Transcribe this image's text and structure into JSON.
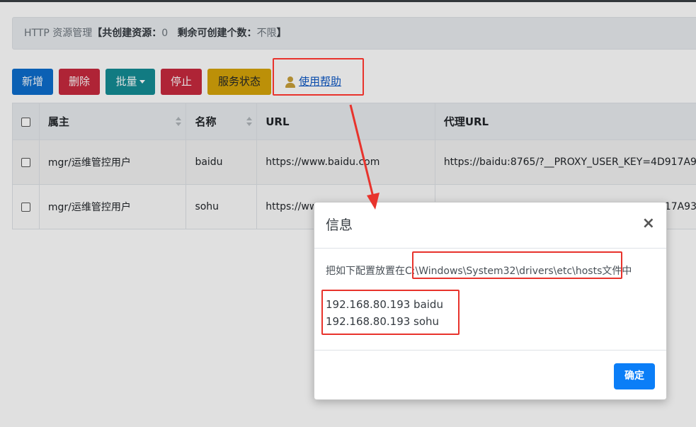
{
  "info_bar": {
    "prefix": "HTTP 资源管理",
    "created_label": "【共创建资源：",
    "created_count": "0",
    "remaining_label": "剩余可创建个数：",
    "remaining_value": "不限",
    "suffix": "】"
  },
  "toolbar": {
    "new_label": "新增",
    "delete_label": "删除",
    "batch_label": "批量",
    "stop_label": "停止",
    "status_label": "服务状态",
    "help_label": "使用帮助"
  },
  "table": {
    "headers": [
      "属主",
      "名称",
      "URL",
      "代理URL"
    ],
    "rows": [
      {
        "owner": "mgr/运维管控用户",
        "name": "baidu",
        "url": "https://www.baidu.com",
        "proxy_url": "https://baidu:8765/?__PROXY_USER_KEY=4D917A9"
      },
      {
        "owner": "mgr/运维管控用户",
        "name": "sohu",
        "url": "https://ww",
        "proxy_url": "17A93"
      }
    ]
  },
  "modal": {
    "title": "信息",
    "close_symbol": "×",
    "instruction_prefix": "把如下配置放置在",
    "instruction_path": "C:\\Windows\\System32\\drivers\\etc\\hosts",
    "instruction_suffix": "文件中",
    "host_lines": [
      "192.168.80.193 baidu",
      "192.168.80.193 sohu"
    ],
    "ok_label": "确定"
  },
  "colors": {
    "primary": "#0d6ecd",
    "danger": "#c82a3e",
    "info": "#148c94",
    "warning": "#d6a40a",
    "annotation": "#e8332c",
    "ok_button": "#0b7ef7"
  }
}
